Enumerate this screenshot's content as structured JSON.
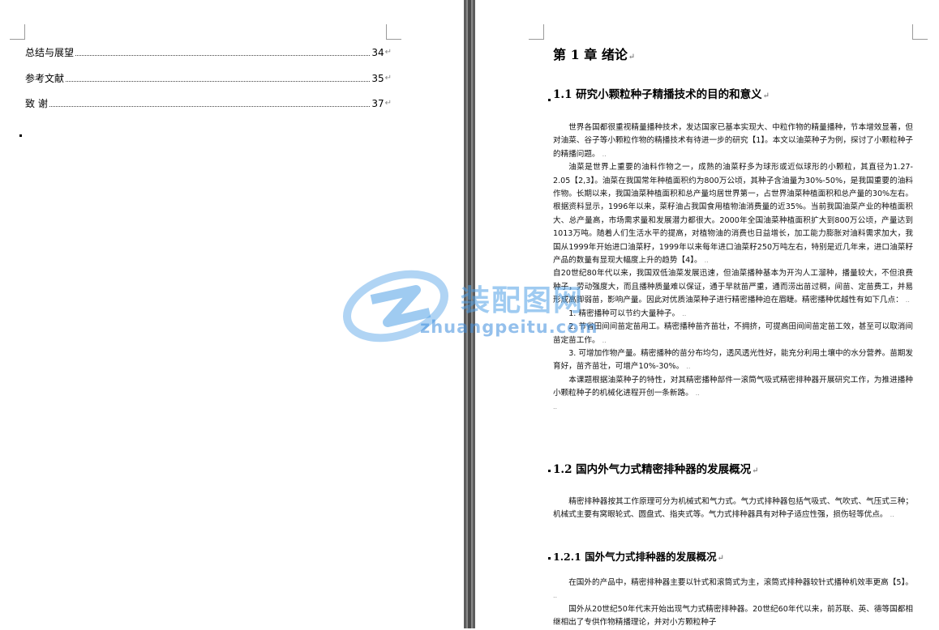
{
  "toc": [
    {
      "title": "总结与展望",
      "page": "34"
    },
    {
      "title": "参考文献",
      "page": "35"
    },
    {
      "title": "致  谢",
      "page": "37"
    }
  ],
  "paragraph_mark": "↵",
  "small_mark": "..",
  "chapter": {
    "title": "第 1 章  绪论"
  },
  "sections": {
    "s1": {
      "title": "1.1  研究小颗粒种子精播技术的目的和意义"
    },
    "s2": {
      "title": "1.2  国内外气力式精密排种器的发展概况"
    },
    "s3": {
      "title": "1.2.1    国外气力式排种器的发展概况"
    }
  },
  "body": {
    "p1": "世界各国都很重视精量播种技术，发达国家已基本实现大、中粒作物的精量播种，节本增效显著，但对油菜、谷子等小颗粒作物的精播技术有待进一步的研究【1】。本文以油菜种子为例，探讨了小颗粒种子的精播问题。",
    "p2": "油菜是世界上重要的油料作物之一，成熟的油菜籽多为球形或近似球形的小颗粒，其直径为1.27-2.05【2,3】。油菜在我国常年种植面积约为800万公顷，其种子含油量为30%-50%，是我国重要的油料作物。长期以来，我国油菜种植面积和总产量均居世界第一，占世界油菜种植面积和总产量的30%左右。根据资料显示，1996年以来，菜籽油占我国食用植物油消费量的近35%。当前我国油菜产业的种植面积大、总产量高，市场需求量和发展潜力都很大。2000年全国油菜种植面积扩大到800万公顷，产量达到1013万吨。随着人们生活水平的提高，对植物油的消费也日益增长，加工能力膨胀对油料需求加大，我国从1999年开始进口油菜籽，1999年以来每年进口油菜籽250万吨左右，特别是近几年来，进口油菜籽产品的数量有显现大幅度上升的趋势【4】。",
    "p3": "自20世纪80年代以来，我国双低油菜发展迅速，但油菜播种基本为开沟人工溜种，播量较大，不但浪费种子，劳动强度大，而且播种质量难以保证，通于早就苗严重，通而涝出苗过稠，间苗、定苗费工，并易形成高脚弱苗，影响产量。因此对优质油菜种子进行精密播种迫在眉睫。精密播种优越性有如下几点：",
    "p4": "1. 精密播种可以节约大量种子。",
    "p5": "2. 节省田间间苗定苗用工。精密播种苗齐苗壮，不拥挤，可提高田间间苗定苗工效，甚至可以取消间苗定苗工作。",
    "p6": "3. 可增加作物产量。精密播种的苗分布均匀，透风透光性好，能充分利用土壤中的水分营养。苗期发育好，苗齐苗壮，可增产10%-30%。",
    "p7": "本课题根据油菜种子的特性，对其精密播种部件一滚筒气吸式精密排种器开展研究工作，为推进播种小颗粒种子的机械化进程开创一条新路。",
    "p8": "精密排种器按其工作原理可分为机械式和气力式。气力式排种器包括气吸式、气吹式、气压式三种；机械式主要有窝眼轮式、圆盘式、指夹式等。气力式排种器具有对种子适应性强，损伤轻等优点。",
    "p9": "在国外的产品中，精密排种器主要以针式和滚筒式为主，滚筒式排种器较针式播种机效率更高【5】。",
    "p10": "国外从20世纪50年代末开始出现气力式精密排种器。20世纪60年代以来，前苏联、英、德等国都相继相出了专供作物精播理论，并对小方颗粒种子"
  },
  "watermark": {
    "cn": "装配图网",
    "en": "zhuangpeitu.com"
  },
  "colors": {
    "gutter": "#8a8a8a",
    "watermark": "#4fa3e6",
    "page": "#ffffff"
  }
}
